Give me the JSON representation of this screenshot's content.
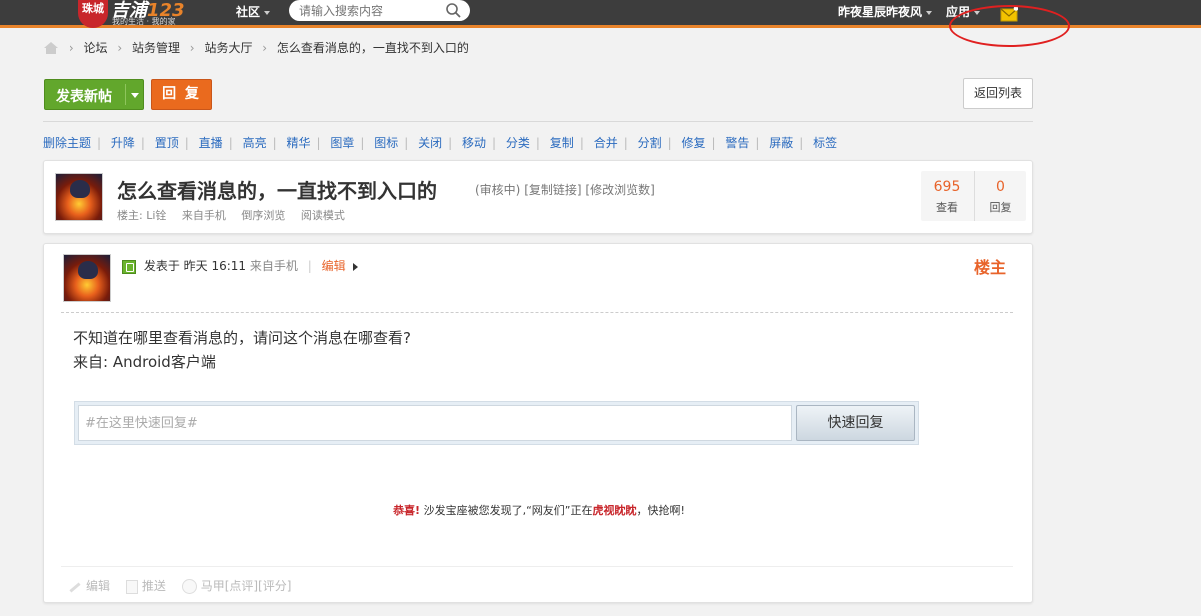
{
  "topbar": {
    "logo_seal": "珠城",
    "logo_title": "吉浦",
    "logo_title_num": "123",
    "logo_subtitle": "我的生活 · 我的家",
    "community_label": "社区",
    "search_placeholder": "请输入搜索内容",
    "username": "昨夜星辰昨夜风",
    "apps_label": "应用"
  },
  "breadcrumb": {
    "items": [
      "论坛",
      "站务管理",
      "站务大厅",
      "怎么查看消息的，一直找不到入口的"
    ]
  },
  "actions": {
    "new_post": "发表新帖",
    "reply": "回 复",
    "back_to_list": "返回列表"
  },
  "moderation": [
    "删除主题",
    "升降",
    "置顶",
    "直播",
    "高亮",
    "精华",
    "图章",
    "图标",
    "关闭",
    "移动",
    "分类",
    "复制",
    "合并",
    "分割",
    "修复",
    "警告",
    "屏蔽",
    "标签"
  ],
  "thread": {
    "title": "怎么查看消息的，一直找不到入口的",
    "status": "(审核中)",
    "copy_link": "[复制链接]",
    "edit_views": "[修改浏览数]",
    "owner": "楼主: Li铨",
    "from_mobile": "来自手机",
    "reverse_view": "倒序浏览",
    "read_mode": "阅读模式",
    "views": "695",
    "views_label": "查看",
    "replies": "0",
    "replies_label": "回复"
  },
  "post": {
    "posted_at": "发表于 昨天 16:11",
    "from_mobile": "来自手机",
    "edit": "编辑",
    "floor_label": "楼主",
    "body_line1": "不知道在哪里查看消息的，请问这个消息在哪查看?",
    "body_line2": "来自: Android客户端",
    "quick_reply_placeholder": "#在这里快速回复#",
    "quick_reply_button": "快速回复",
    "sofa_congrats": "恭喜!",
    "sofa_text1": "沙发宝座被您发现了,",
    "sofa_text2": "“网友们”正在",
    "sofa_highlight": "虎视眈眈",
    "sofa_text3": "，快抢啊!",
    "footer_edit": "编辑",
    "footer_push": "推送",
    "footer_majia": "马甲[点评][评分]"
  }
}
